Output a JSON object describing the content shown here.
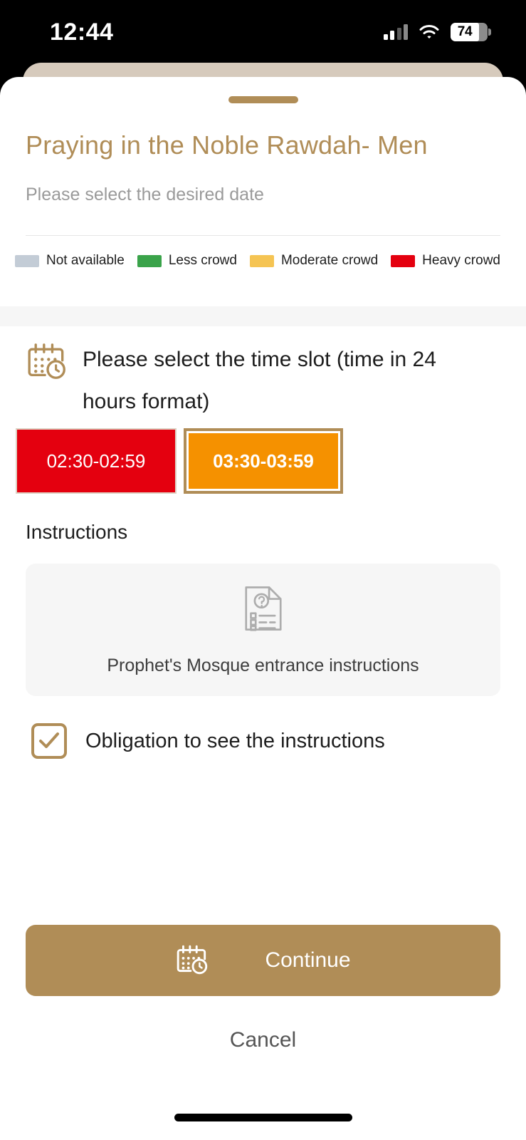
{
  "status_bar": {
    "time": "12:44",
    "battery_level": "74",
    "signal_icon": "cellular-signal-icon",
    "wifi_icon": "wifi-icon",
    "battery_icon": "battery-icon"
  },
  "sheet": {
    "grabber": "drag-handle",
    "title": "Praying in the Noble Rawdah- Men",
    "subtitle": "Please select the desired date"
  },
  "legend": {
    "items": [
      {
        "label": "Not available",
        "color": "#c3ccd6"
      },
      {
        "label": "Less crowd",
        "color": "#3aa34a"
      },
      {
        "label": "Moderate crowd",
        "color": "#f5c453"
      },
      {
        "label": "Heavy crowd",
        "color": "#e4000f"
      }
    ]
  },
  "time_slots": {
    "icon": "calendar-clock-icon",
    "heading": "Please select the time slot (time in 24 hours format)",
    "slots": [
      {
        "label": "02:30-02:59",
        "crowd": "Heavy crowd",
        "selected": false,
        "color": "#e4000f"
      },
      {
        "label": "03:30-03:59",
        "crowd": "Moderate crowd",
        "selected": true,
        "color": "#f59100"
      }
    ]
  },
  "instructions": {
    "section_title": "Instructions",
    "card_icon": "document-question-icon",
    "card_label": "Prophet's Mosque entrance instructions",
    "checkbox_label": "Obligation to see the instructions",
    "checkbox_checked": true,
    "checkbox_icon": "checkmark-icon"
  },
  "actions": {
    "continue_label": "Continue",
    "continue_icon": "calendar-clock-icon",
    "cancel_label": "Cancel",
    "accent_color": "#b08d57"
  }
}
